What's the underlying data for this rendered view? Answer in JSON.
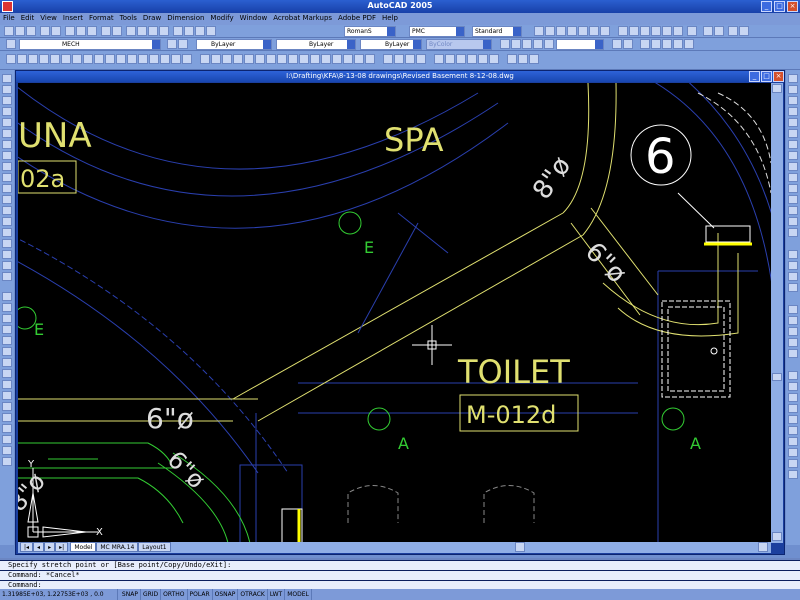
{
  "app": {
    "title": "AutoCAD 2005",
    "drawing_title": "I:\\Drafting\\KFA\\8-13-08 drawings\\Revised Basement 8-12-08.dwg"
  },
  "menu": [
    "File",
    "Edit",
    "View",
    "Insert",
    "Format",
    "Tools",
    "Draw",
    "Dimension",
    "Modify",
    "Window",
    "Acrobat Markups",
    "Adobe PDF",
    "Help"
  ],
  "toolbar": {
    "text_style": "RomanS",
    "dim_style": "PMC",
    "table_style": "Standard",
    "layer": "MECH",
    "color": "ByLayer",
    "linetype": "ByLayer",
    "lineweight": "ByLayer",
    "plotstyle": "ByColor"
  },
  "drawing_labels": {
    "una": "UNA",
    "tag_02a": "02a",
    "spa": "SPA",
    "toilet": "TOILET",
    "m012d": "M-012d",
    "six_circle": "6",
    "e1": "E",
    "e2": "E",
    "a1": "A",
    "a2": "A",
    "duct1": "8\"ø",
    "duct2": "6\"ø",
    "duct3": "6\"ø",
    "duct4": "6\"ø",
    "duct5": "8\"ø",
    "ucs_y": "Y",
    "ucs_x": "X"
  },
  "tabs": [
    "Model",
    "MC MRA.14",
    "Layout1"
  ],
  "command": {
    "line1": "Specify stretch point or [Base point/Copy/Undo/eXit]:",
    "line2": "Command: *Cancel*",
    "prompt": "Command:"
  },
  "status": {
    "coords": "1.31985E+03, 1.22753E+03 , 0.0",
    "buttons": [
      "SNAP",
      "GRID",
      "ORTHO",
      "POLAR",
      "OSNAP",
      "OTRACK",
      "LWT",
      "MODEL"
    ]
  }
}
